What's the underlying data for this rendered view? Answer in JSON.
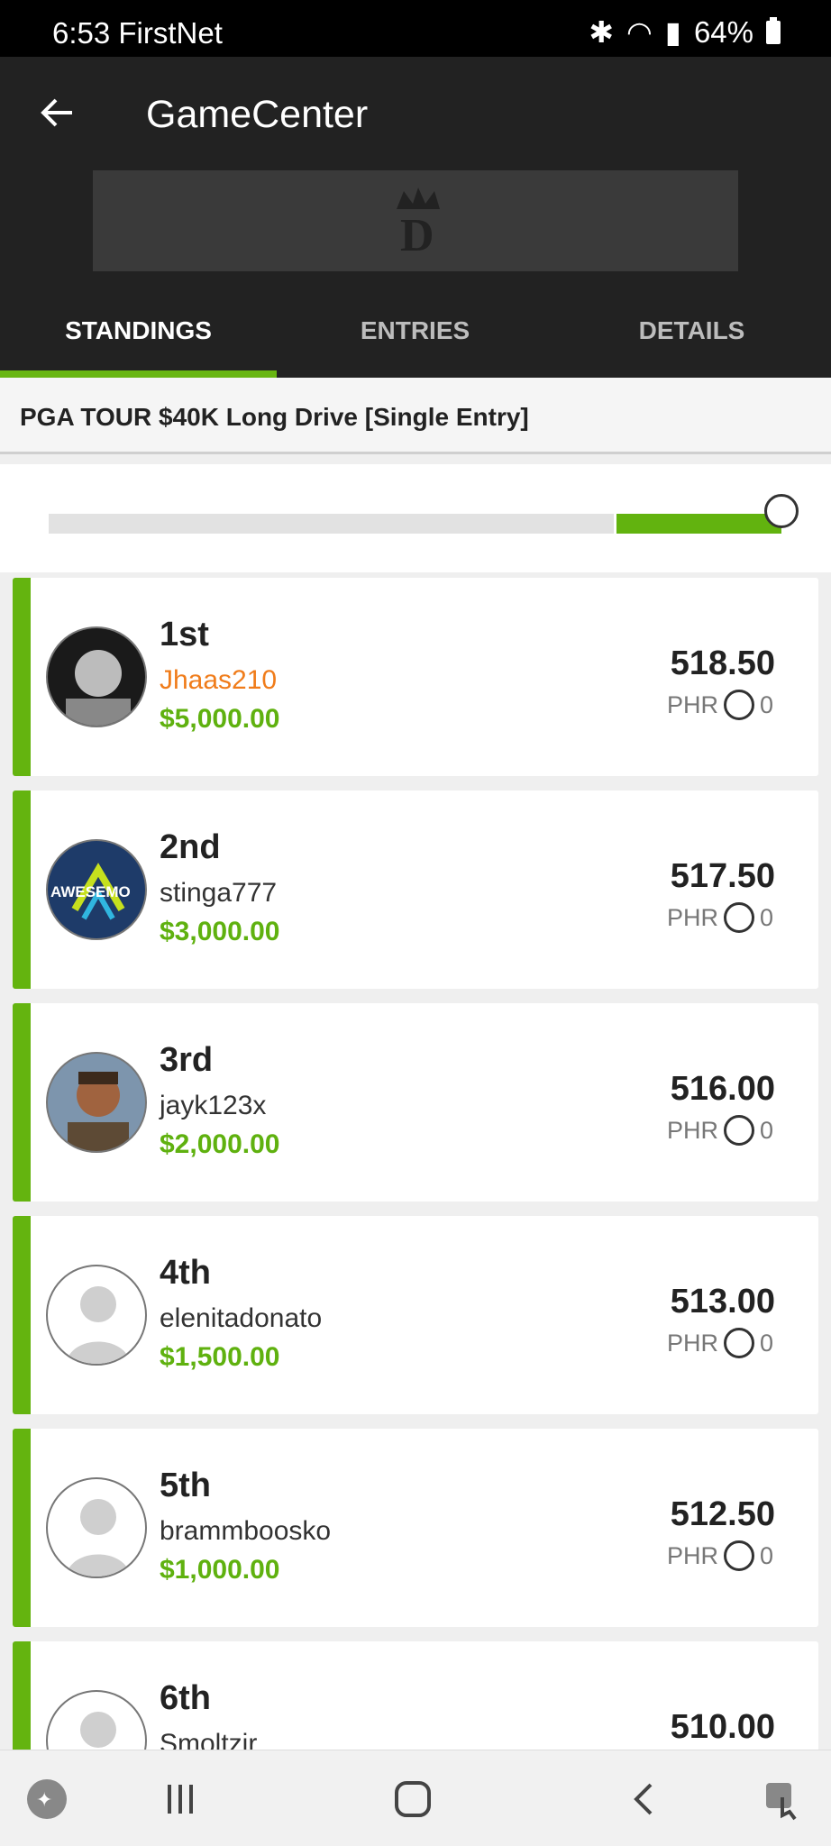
{
  "status": {
    "time": "6:53 FirstNet",
    "battery": "64%"
  },
  "app": {
    "title": "GameCenter"
  },
  "tabs": [
    "STANDINGS",
    "ENTRIES",
    "DETAILS"
  ],
  "contest_name": "PGA TOUR $40K Long Drive [Single Entry]",
  "slider": {
    "progress_fraction": 1.0
  },
  "entries": [
    {
      "rank": "1st",
      "user": "Jhaas210",
      "prize": "$5,000.00",
      "points": "518.50",
      "phr_label": "PHR",
      "phr": "0"
    },
    {
      "rank": "2nd",
      "user": "stinga777",
      "prize": "$3,000.00",
      "points": "517.50",
      "phr_label": "PHR",
      "phr": "0"
    },
    {
      "rank": "3rd",
      "user": "jayk123x",
      "prize": "$2,000.00",
      "points": "516.00",
      "phr_label": "PHR",
      "phr": "0"
    },
    {
      "rank": "4th",
      "user": "elenitadonato",
      "prize": "$1,500.00",
      "points": "513.00",
      "phr_label": "PHR",
      "phr": "0"
    },
    {
      "rank": "5th",
      "user": "brammboosko",
      "prize": "$1,000.00",
      "points": "512.50",
      "phr_label": "PHR",
      "phr": "0"
    },
    {
      "rank": "6th",
      "user": "Smoltzir",
      "prize": "",
      "points": "510.00",
      "phr_label": "",
      "phr": ""
    }
  ],
  "avatar_overlay_text": "AWESEMO"
}
